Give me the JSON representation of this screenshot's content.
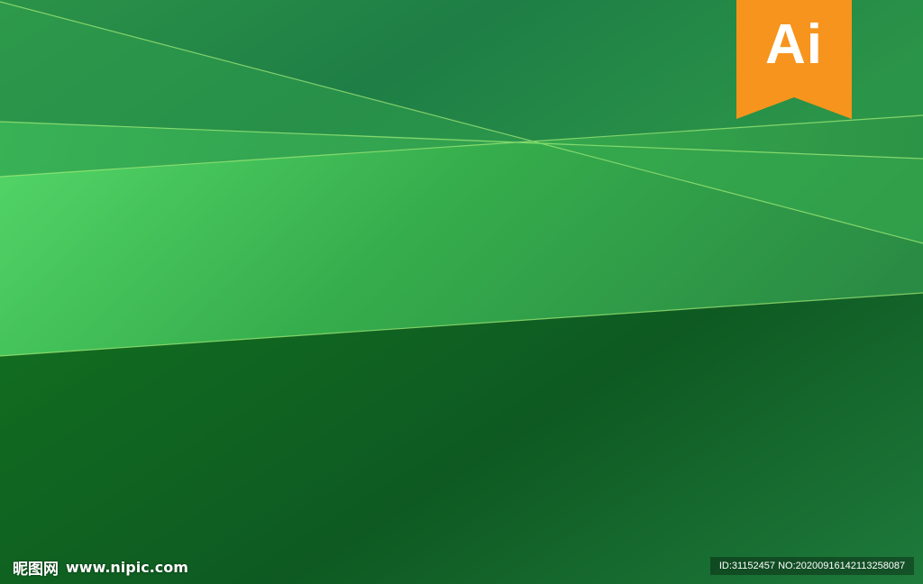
{
  "badge": {
    "text": "Ai",
    "color": "#f7941d",
    "text_color": "#ffffff"
  },
  "watermark": {
    "brand": "昵图网",
    "site": "www.nipic.com",
    "id_text": "ID:31152457 NO:20200916142113258087"
  },
  "colors": {
    "dark_green": "#0f5a24",
    "mid_green": "#2e9a48",
    "light_green": "#57d86a",
    "line_color": "#a8f07a"
  }
}
